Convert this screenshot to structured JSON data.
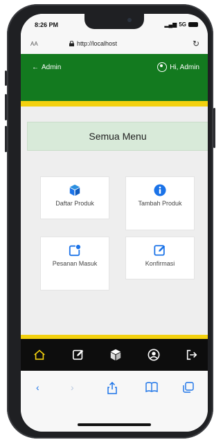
{
  "status_bar": {
    "time": "8:26 PM",
    "network": "5G"
  },
  "browser": {
    "text_size_button": "AA",
    "url": "http://localhost",
    "reload_icon": "reload-icon"
  },
  "header": {
    "back_label": "Admin",
    "user_label": "Hi, Admin"
  },
  "page": {
    "title": "Semua Menu"
  },
  "menu": [
    {
      "label": "Daftar Produk",
      "icon": "cube-icon"
    },
    {
      "label": "Tambah Produk",
      "icon": "info-icon"
    },
    {
      "label": "Pesanan Masuk",
      "icon": "notification-icon"
    },
    {
      "label": "Konfirmasi",
      "icon": "edit-icon"
    }
  ],
  "tab_bar": [
    "home-icon",
    "edit-icon",
    "cube-icon",
    "account-icon",
    "logout-icon"
  ],
  "browser_nav": [
    "back-icon",
    "forward-icon",
    "share-icon",
    "bookmarks-icon",
    "tabs-icon"
  ],
  "colors": {
    "header_green": "#137a1f",
    "accent_yellow": "#f3d10f",
    "icon_blue": "#1b73e8",
    "title_card": "#d8ead9"
  }
}
